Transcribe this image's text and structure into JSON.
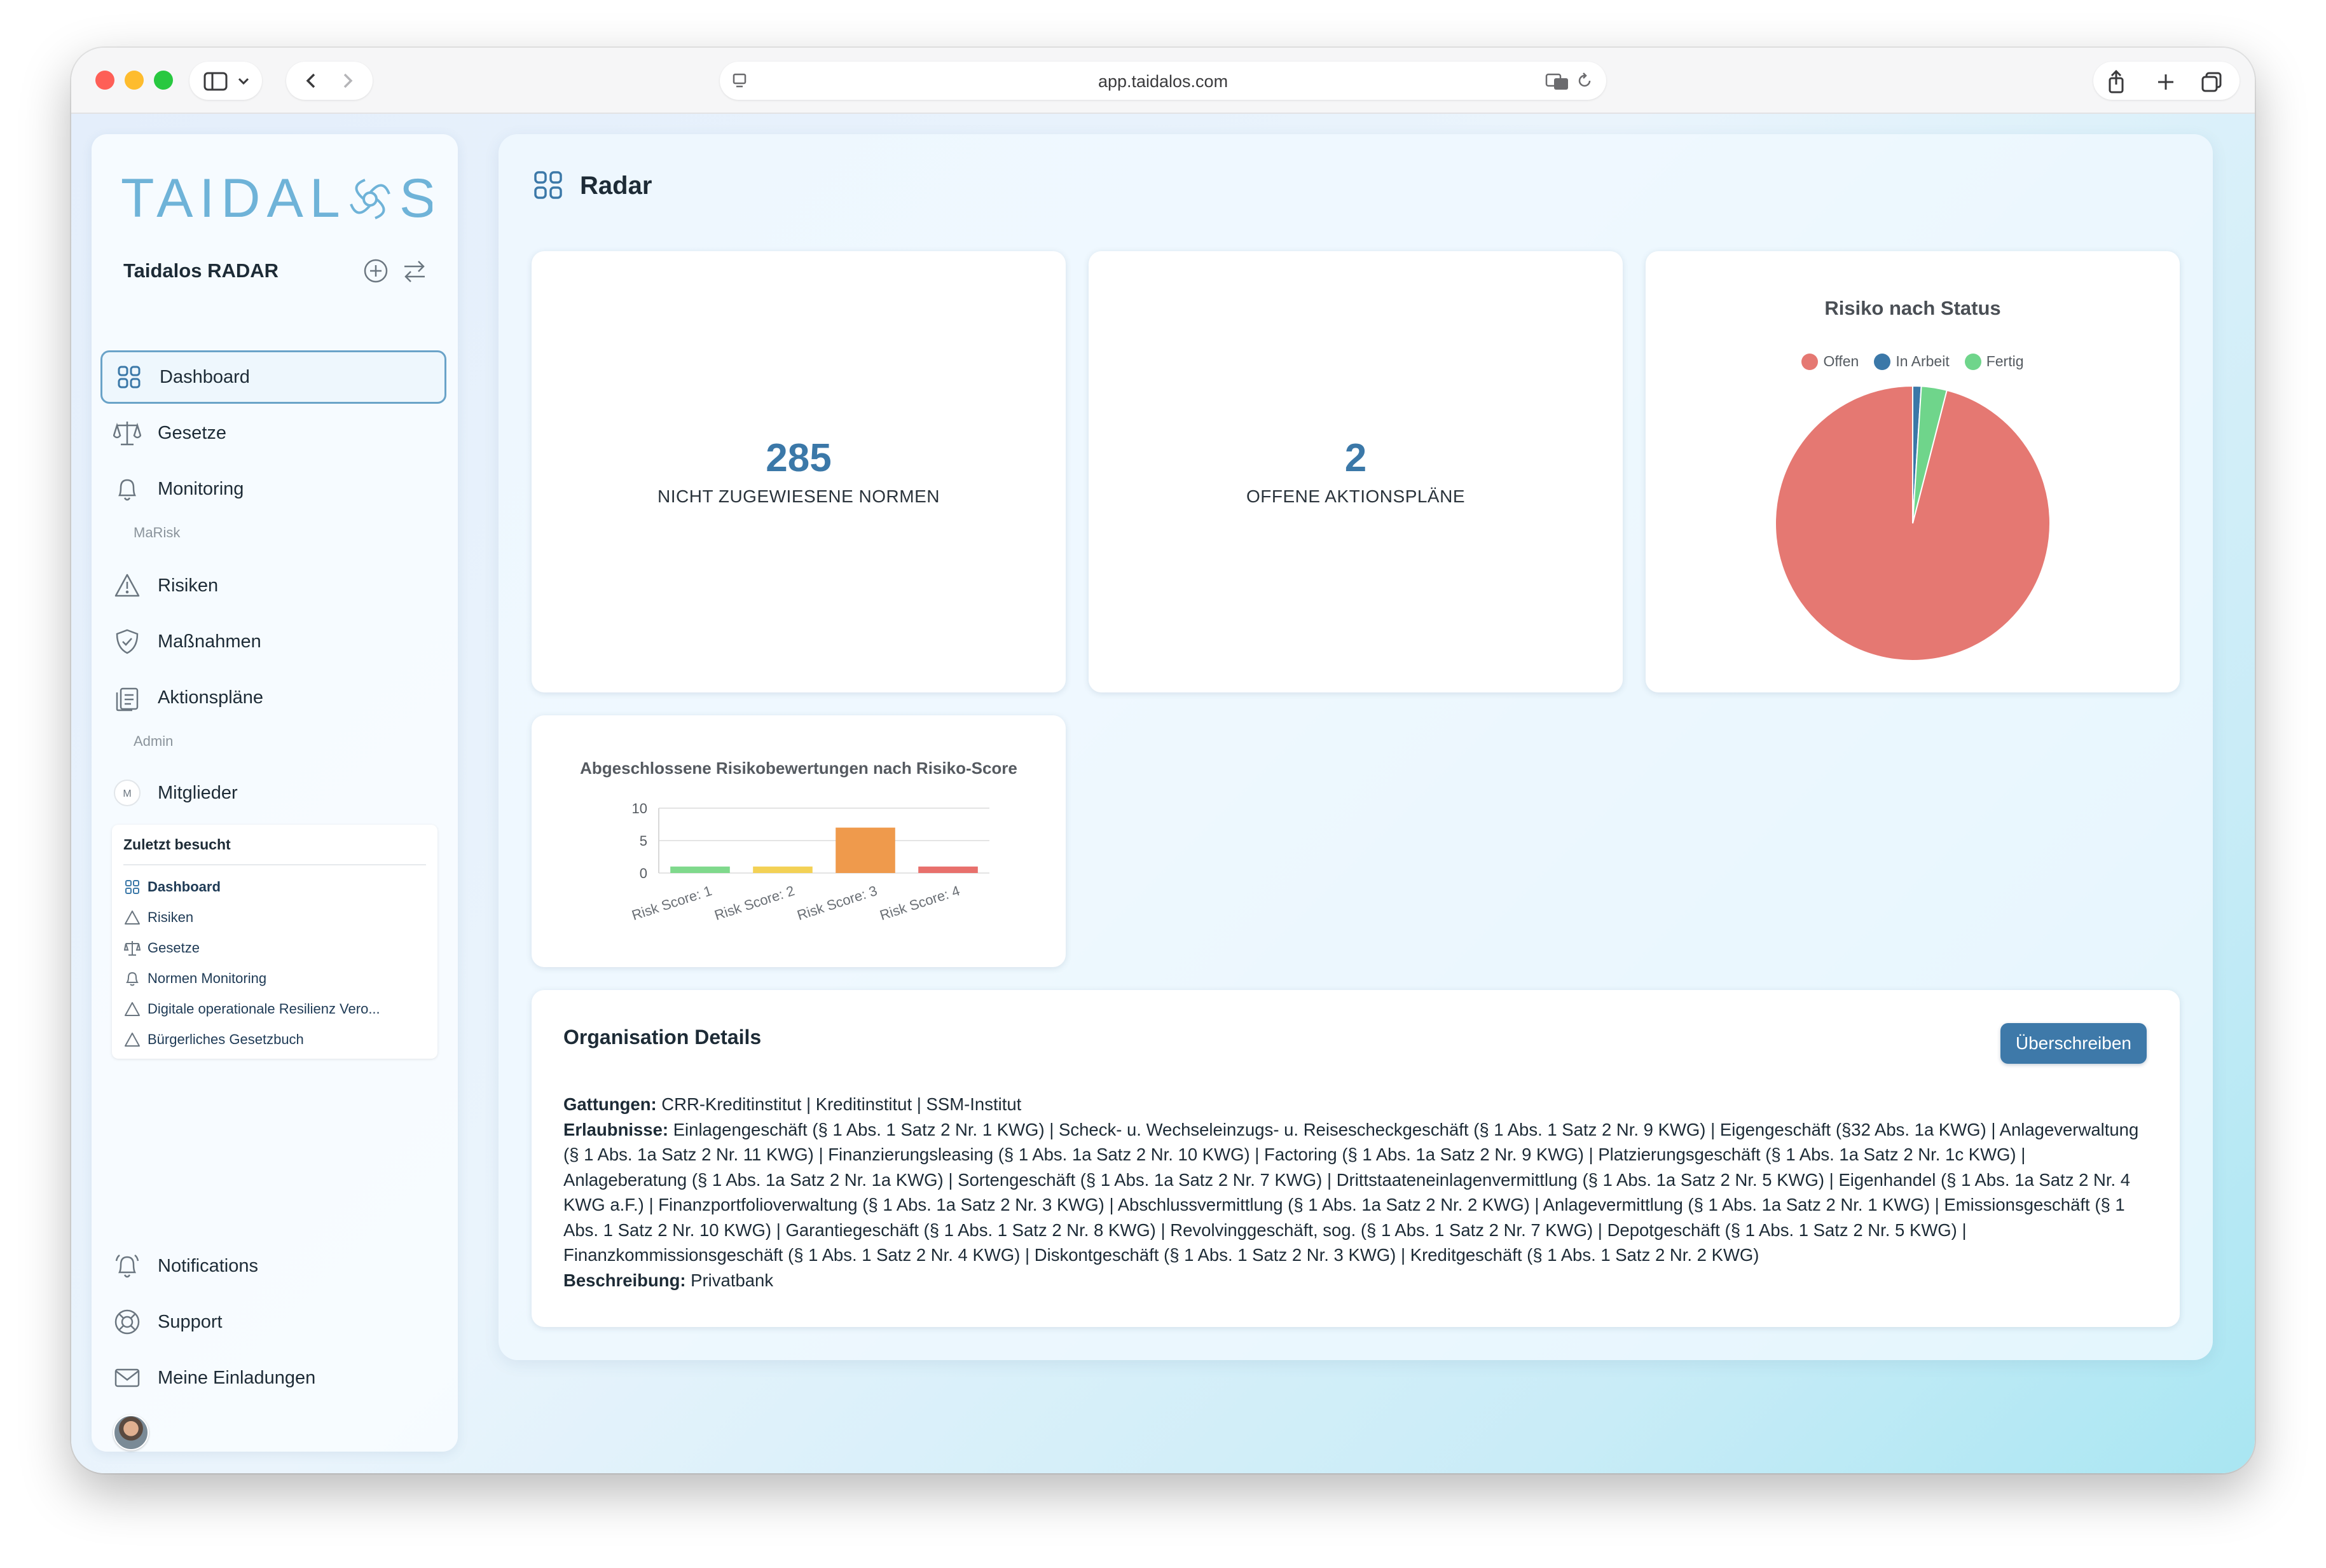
{
  "browser": {
    "url": "app.taidalos.com"
  },
  "sidebar": {
    "logo_text": "TAIDALOS",
    "org_name": "Taidalos RADAR",
    "nav": [
      {
        "label": "Dashboard",
        "icon": "grid-icon",
        "active": true
      },
      {
        "label": "Gesetze",
        "icon": "scale-icon"
      },
      {
        "label": "Monitoring",
        "icon": "bell-icon"
      }
    ],
    "section_marisk": "MaRisk",
    "marisk_nav": [
      {
        "label": "Risiken",
        "icon": "warning-icon"
      },
      {
        "label": "Maßnahmen",
        "icon": "shield-icon"
      },
      {
        "label": "Aktionspläne",
        "icon": "clipboard-icon"
      }
    ],
    "section_admin": "Admin",
    "admin_nav": [
      {
        "label": "Mitglieder",
        "icon": "avatar-m-icon",
        "avatar_letter": "M"
      }
    ],
    "recent": {
      "title": "Zuletzt besucht",
      "items": [
        {
          "label": "Dashboard",
          "icon": "grid-icon"
        },
        {
          "label": "Risiken",
          "icon": "warning-icon"
        },
        {
          "label": "Gesetze",
          "icon": "scale-icon"
        },
        {
          "label": "Normen Monitoring",
          "icon": "bell-icon"
        },
        {
          "label": "Digitale operationale Resilienz Vero...",
          "icon": "warning-icon"
        },
        {
          "label": "Bürgerliches Gesetzbuch",
          "icon": "warning-icon"
        }
      ]
    },
    "bottom_nav": [
      {
        "label": "Notifications",
        "icon": "bell-ring-icon"
      },
      {
        "label": "Support",
        "icon": "lifebuoy-icon"
      },
      {
        "label": "Meine Einladungen",
        "icon": "mail-icon"
      }
    ]
  },
  "main": {
    "title": "Radar",
    "stats": [
      {
        "value": "285",
        "label": "NICHT ZUGEWIESENE NORMEN"
      },
      {
        "value": "2",
        "label": "OFFENE AKTIONSPLÄNE"
      }
    ],
    "org": {
      "title": "Organisation Details",
      "button": "Überschreiben",
      "gattungen_label": "Gattungen:",
      "gattungen_value": "CRR-Kreditinstitut | Kreditinstitut | SSM-Institut",
      "erlaubnisse_label": "Erlaubnisse:",
      "erlaubnisse_value": "Einlagengeschäft (§ 1 Abs. 1 Satz 2 Nr. 1 KWG) | Scheck- u. Wechseleinzugs- u. Reisescheckgeschäft (§ 1 Abs. 1 Satz 2 Nr. 9 KWG) | Eigengeschäft (§32 Abs. 1a KWG) | Anlageverwaltung (§ 1 Abs. 1a Satz 2 Nr. 11 KWG) | Finanzierungsleasing (§ 1 Abs. 1a Satz 2 Nr. 10 KWG) | Factoring (§ 1 Abs. 1a Satz 2 Nr. 9 KWG) | Platzierungsgeschäft (§ 1 Abs. 1a Satz 2 Nr. 1c KWG) | Anlageberatung (§ 1 Abs. 1a Satz 2 Nr. 1a KWG) | Sortengeschäft (§ 1 Abs. 1a Satz 2 Nr. 7 KWG) | Drittstaateneinlagenvermittlung (§ 1 Abs. 1a Satz 2 Nr. 5 KWG) | Eigenhandel (§ 1 Abs. 1a Satz 2 Nr. 4 KWG a.F.) | Finanzportfolioverwaltung (§ 1 Abs. 1a Satz 2 Nr. 3 KWG) | Abschlussvermittlung (§ 1 Abs. 1a Satz 2 Nr. 2 KWG) | Anlagevermittlung (§ 1 Abs. 1a Satz 2 Nr. 1 KWG) | Emissionsgeschäft (§ 1 Abs. 1 Satz 2 Nr. 10 KWG) | Garantiegeschäft (§ 1 Abs. 1 Satz 2 Nr. 8 KWG) | Revolvinggeschäft, sog. (§ 1 Abs. 1 Satz 2 Nr. 7 KWG) | Depotgeschäft (§ 1 Abs. 1 Satz 2 Nr. 5 KWG) | Finanzkommissionsgeschäft (§ 1 Abs. 1 Satz 2 Nr. 4 KWG) | Diskontgeschäft (§ 1 Abs. 1 Satz 2 Nr. 3 KWG) | Kreditgeschäft (§ 1 Abs. 1 Satz 2 Nr. 2 KWG)",
      "beschreibung_label": "Beschreibung:",
      "beschreibung_value": "Privatbank"
    }
  },
  "colors": {
    "accent": "#3e79a9",
    "offen": "#e57872",
    "in_arbeit": "#3b78a8",
    "fertig": "#6fd58b",
    "bar_1": "#7fd98c",
    "bar_2": "#f3d155",
    "bar_3": "#ef9a4c",
    "bar_4": "#e8706c"
  },
  "chart_data": [
    {
      "type": "pie",
      "title": "Risiko nach Status",
      "legend_position": "top",
      "categories": [
        "Offen",
        "In Arbeit",
        "Fertig"
      ],
      "values": [
        96,
        1,
        3
      ]
    },
    {
      "type": "bar",
      "title": "Abgeschlossene Risikobewertungen nach Risiko-Score",
      "categories": [
        "Risk Score: 1",
        "Risk Score: 2",
        "Risk Score: 3",
        "Risk Score: 4"
      ],
      "values": [
        1,
        1,
        7,
        1
      ],
      "ylim": [
        0,
        10
      ],
      "yticks": [
        0,
        5,
        10
      ],
      "grid": true
    }
  ]
}
